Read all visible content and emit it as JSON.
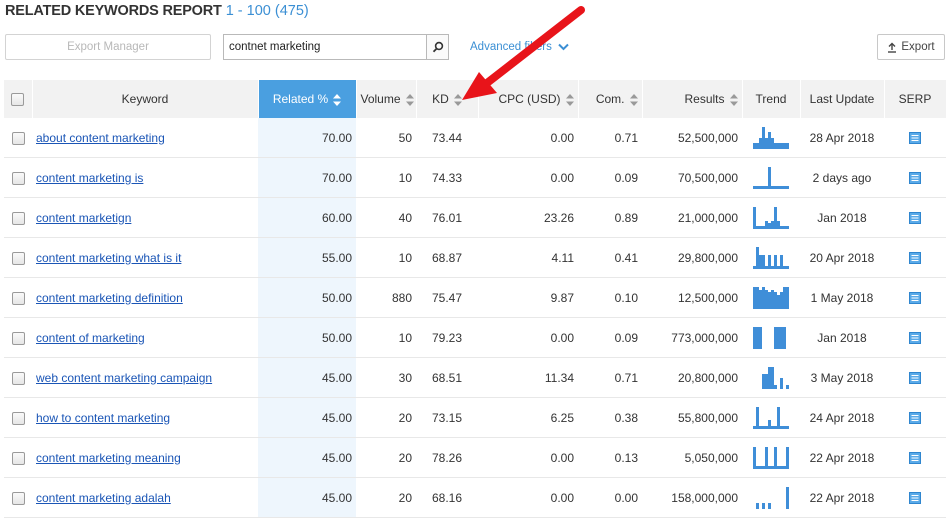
{
  "header": {
    "title": "RELATED KEYWORDS REPORT",
    "range": "1 - 100 (475)"
  },
  "toolbar": {
    "export_manager_label": "Export Manager",
    "search_value": "contnet marketing",
    "advanced_filters_label": "Advanced filters",
    "export_label": "Export"
  },
  "columns": [
    "Keyword",
    "Related %",
    "Volume",
    "KD",
    "CPC (USD)",
    "Com.",
    "Results",
    "Trend",
    "Last Update",
    "SERP"
  ],
  "colors": {
    "accent": "#4a9fe0",
    "link": "#1a55b6",
    "trend": "#3f8ed8",
    "arrow": "#e8141a"
  },
  "rows": [
    {
      "keyword": "about content marketing",
      "related": "70.00",
      "volume": "50",
      "kd": "73.44",
      "cpc": "0.00",
      "com": "0.71",
      "results": "52,500,000",
      "last_update": "28 Apr 2018",
      "trend": [
        1,
        1,
        2,
        4,
        2,
        3,
        2,
        1,
        1,
        1,
        1,
        1
      ]
    },
    {
      "keyword": "content marketing is",
      "related": "70.00",
      "volume": "10",
      "kd": "74.33",
      "cpc": "0.00",
      "com": "0.09",
      "results": "70,500,000",
      "last_update": "2 days ago",
      "trend": [
        1,
        1,
        1,
        1,
        1,
        8,
        1,
        1,
        1,
        1,
        1,
        1
      ]
    },
    {
      "keyword": "content marketign",
      "related": "60.00",
      "volume": "40",
      "kd": "76.01",
      "cpc": "23.26",
      "com": "0.89",
      "results": "21,000,000",
      "last_update": "Jan 2018",
      "trend": [
        8,
        1,
        1,
        1,
        3,
        2,
        3,
        8,
        3,
        1,
        1,
        1
      ]
    },
    {
      "keyword": "content marketing what is it",
      "related": "55.00",
      "volume": "10",
      "kd": "68.87",
      "cpc": "4.11",
      "com": "0.41",
      "results": "29,800,000",
      "last_update": "20 Apr 2018",
      "trend": [
        1,
        8,
        5,
        5,
        1,
        5,
        1,
        5,
        1,
        5,
        1,
        1
      ]
    },
    {
      "keyword": "content marketing definition",
      "related": "50.00",
      "volume": "880",
      "kd": "75.47",
      "cpc": "9.87",
      "com": "0.10",
      "results": "12,500,000",
      "last_update": "1 May 2018",
      "trend": [
        8,
        8,
        7,
        8,
        7,
        6,
        7,
        6,
        5,
        6,
        8,
        8
      ]
    },
    {
      "keyword": "content of marketing",
      "related": "50.00",
      "volume": "10",
      "kd": "79.23",
      "cpc": "0.00",
      "com": "0.09",
      "results": "773,000,000",
      "last_update": "Jan 2018",
      "trend": [
        8,
        8,
        8,
        0,
        0,
        0,
        0,
        8,
        8,
        8,
        8,
        0
      ]
    },
    {
      "keyword": "web content marketing campaign",
      "related": "45.00",
      "volume": "30",
      "kd": "68.51",
      "cpc": "11.34",
      "com": "0.71",
      "results": "20,800,000",
      "last_update": "3 May 2018",
      "trend": [
        0,
        0,
        0,
        4,
        4,
        6,
        6,
        1,
        0,
        3,
        0,
        1
      ]
    },
    {
      "keyword": "how to content marketing",
      "related": "45.00",
      "volume": "20",
      "kd": "73.15",
      "cpc": "6.25",
      "com": "0.38",
      "results": "55,800,000",
      "last_update": "24 Apr 2018",
      "trend": [
        1,
        7,
        1,
        1,
        1,
        3,
        1,
        1,
        7,
        1,
        1,
        1
      ]
    },
    {
      "keyword": "content marketing meaning",
      "related": "45.00",
      "volume": "20",
      "kd": "78.26",
      "cpc": "0.00",
      "com": "0.13",
      "results": "5,050,000",
      "last_update": "22 Apr 2018",
      "trend": [
        8,
        1,
        1,
        1,
        8,
        1,
        1,
        8,
        1,
        1,
        1,
        8
      ]
    },
    {
      "keyword": "content marketing adalah",
      "related": "45.00",
      "volume": "20",
      "kd": "68.16",
      "cpc": "0.00",
      "com": "0.00",
      "results": "158,000,000",
      "last_update": "22 Apr 2018",
      "trend": [
        0,
        2,
        0,
        2,
        0,
        2,
        0,
        0,
        0,
        0,
        0,
        8
      ]
    }
  ]
}
